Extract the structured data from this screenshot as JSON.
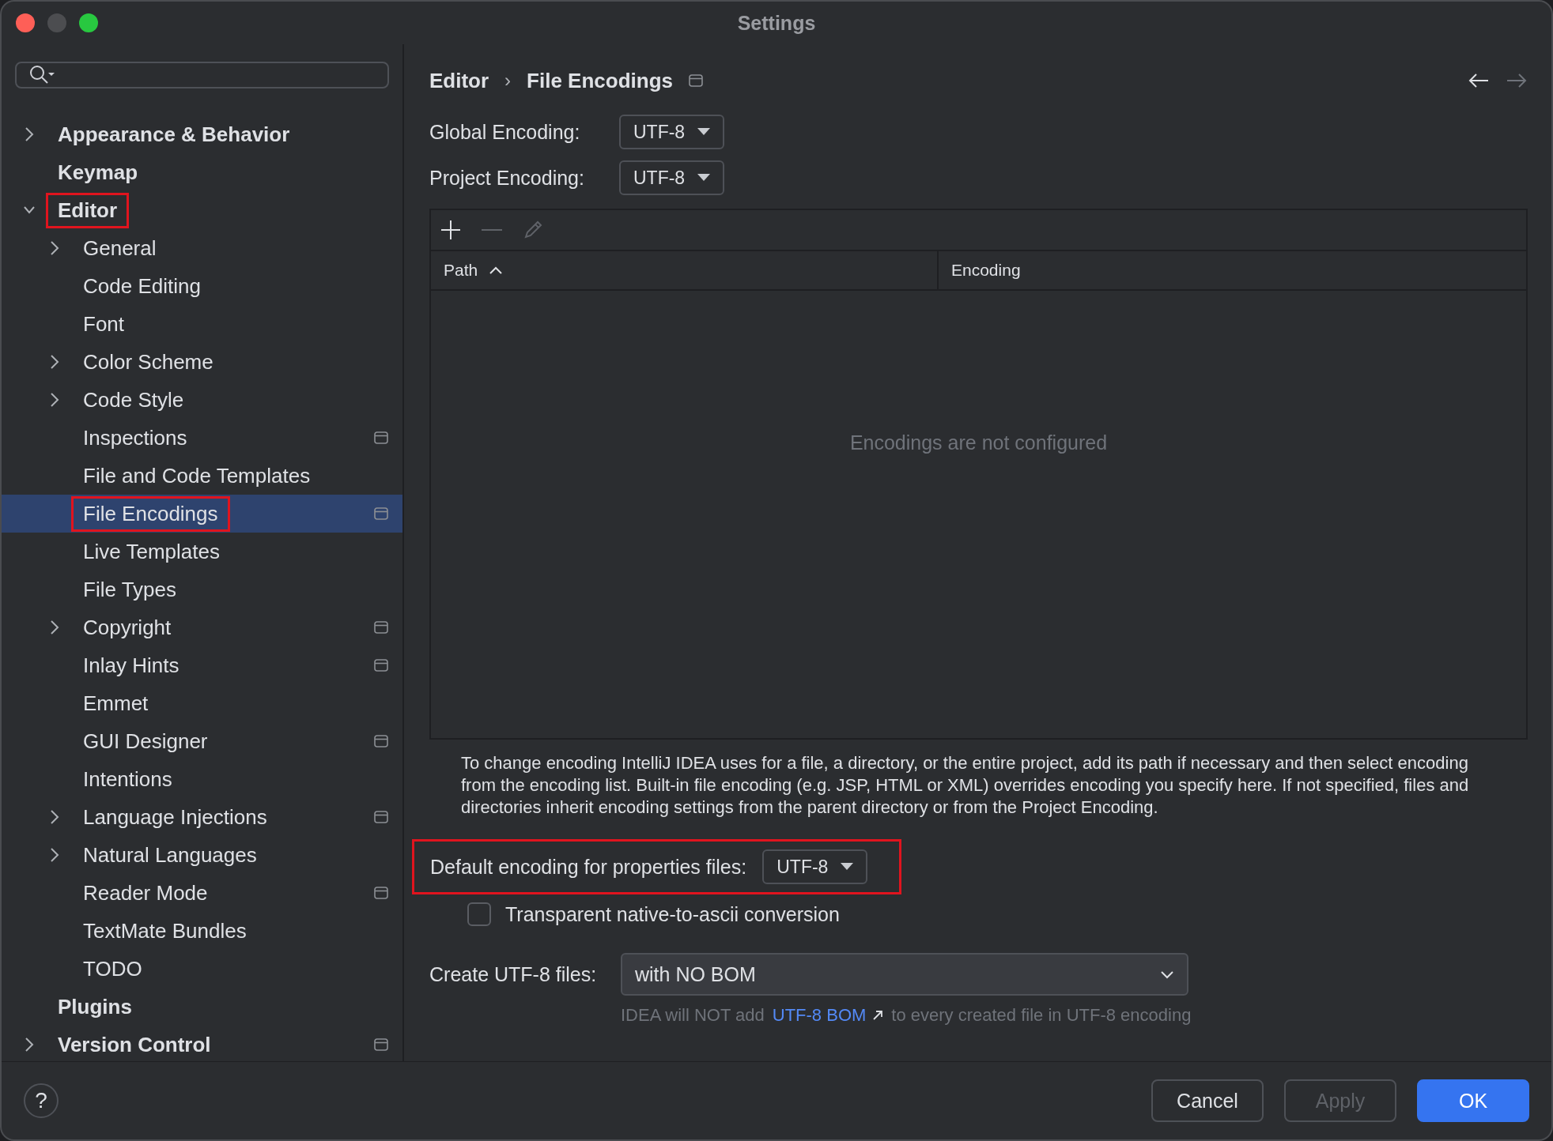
{
  "window": {
    "title": "Settings"
  },
  "sidebar": {
    "items": [
      {
        "label": "Appearance & Behavior",
        "bold": true,
        "expanded": false,
        "selected": false,
        "scoped": false,
        "highlighted": false
      },
      {
        "label": "Keymap",
        "bold": true,
        "selected": false,
        "scoped": false,
        "highlighted": false
      },
      {
        "label": "Editor",
        "bold": true,
        "expanded": true,
        "selected": false,
        "scoped": false,
        "highlighted": true,
        "children": [
          {
            "label": "General",
            "bold": false,
            "expanded": false,
            "selected": false,
            "scoped": false,
            "highlighted": false
          },
          {
            "label": "Code Editing",
            "bold": false,
            "selected": false,
            "scoped": false,
            "highlighted": false
          },
          {
            "label": "Font",
            "bold": false,
            "selected": false,
            "scoped": false,
            "highlighted": false
          },
          {
            "label": "Color Scheme",
            "bold": false,
            "expanded": false,
            "selected": false,
            "scoped": false,
            "highlighted": false
          },
          {
            "label": "Code Style",
            "bold": false,
            "expanded": false,
            "selected": false,
            "scoped": false,
            "highlighted": false
          },
          {
            "label": "Inspections",
            "bold": false,
            "selected": false,
            "scoped": true,
            "highlighted": false
          },
          {
            "label": "File and Code Templates",
            "bold": false,
            "selected": false,
            "scoped": false,
            "highlighted": false
          },
          {
            "label": "File Encodings",
            "bold": false,
            "selected": true,
            "scoped": true,
            "highlighted": true
          },
          {
            "label": "Live Templates",
            "bold": false,
            "selected": false,
            "scoped": false,
            "highlighted": false
          },
          {
            "label": "File Types",
            "bold": false,
            "selected": false,
            "scoped": false,
            "highlighted": false
          },
          {
            "label": "Copyright",
            "bold": false,
            "expanded": false,
            "selected": false,
            "scoped": true,
            "highlighted": false
          },
          {
            "label": "Inlay Hints",
            "bold": false,
            "selected": false,
            "scoped": true,
            "highlighted": false
          },
          {
            "label": "Emmet",
            "bold": false,
            "selected": false,
            "scoped": false,
            "highlighted": false
          },
          {
            "label": "GUI Designer",
            "bold": false,
            "selected": false,
            "scoped": true,
            "highlighted": false
          },
          {
            "label": "Intentions",
            "bold": false,
            "selected": false,
            "scoped": false,
            "highlighted": false
          },
          {
            "label": "Language Injections",
            "bold": false,
            "expanded": false,
            "selected": false,
            "scoped": true,
            "highlighted": false
          },
          {
            "label": "Natural Languages",
            "bold": false,
            "expanded": false,
            "selected": false,
            "scoped": false,
            "highlighted": false
          },
          {
            "label": "Reader Mode",
            "bold": false,
            "selected": false,
            "scoped": true,
            "highlighted": false
          },
          {
            "label": "TextMate Bundles",
            "bold": false,
            "selected": false,
            "scoped": false,
            "highlighted": false
          },
          {
            "label": "TODO",
            "bold": false,
            "selected": false,
            "scoped": false,
            "highlighted": false
          }
        ]
      },
      {
        "label": "Plugins",
        "bold": true,
        "selected": false,
        "scoped": false,
        "highlighted": false
      },
      {
        "label": "Version Control",
        "bold": true,
        "expanded": false,
        "selected": false,
        "scoped": true,
        "highlighted": false
      }
    ]
  },
  "breadcrumb": {
    "items": [
      "Editor",
      "File Encodings"
    ],
    "separator": "›",
    "scoped": true
  },
  "encodings": [
    {
      "label": "Global Encoding:",
      "value": "UTF-8"
    },
    {
      "label": "Project Encoding:",
      "value": "UTF-8"
    }
  ],
  "table": {
    "columns": [
      {
        "label": "Path",
        "sorted": true
      },
      {
        "label": "Encoding",
        "sorted": false
      }
    ],
    "empty_text": "Encodings are not configured"
  },
  "description": "To change encoding IntelliJ IDEA uses for a file, a directory, or the entire project, add its path if necessary and then select encoding from the encoding list. Built-in file encoding (e.g. JSP, HTML or XML) overrides encoding you specify here. If not specified, files and directories inherit encoding settings from the parent directory or from the Project Encoding.",
  "properties": {
    "label": "Default encoding for properties files:",
    "value": "UTF-8",
    "highlighted": true
  },
  "native_to_ascii": {
    "label": "Transparent native-to-ascii conversion",
    "checked": false
  },
  "create_utf8": {
    "label": "Create UTF-8 files:",
    "value": "with NO BOM"
  },
  "bom_hint": {
    "before": "IDEA will NOT add",
    "link": "UTF-8 BOM",
    "after": "to every created file in UTF-8 encoding"
  },
  "buttons": [
    {
      "label": "Cancel",
      "kind": "normal",
      "disabled": false
    },
    {
      "label": "Apply",
      "kind": "normal",
      "disabled": true
    },
    {
      "label": "OK",
      "kind": "primary",
      "disabled": false
    }
  ],
  "help": {
    "label": "?"
  }
}
